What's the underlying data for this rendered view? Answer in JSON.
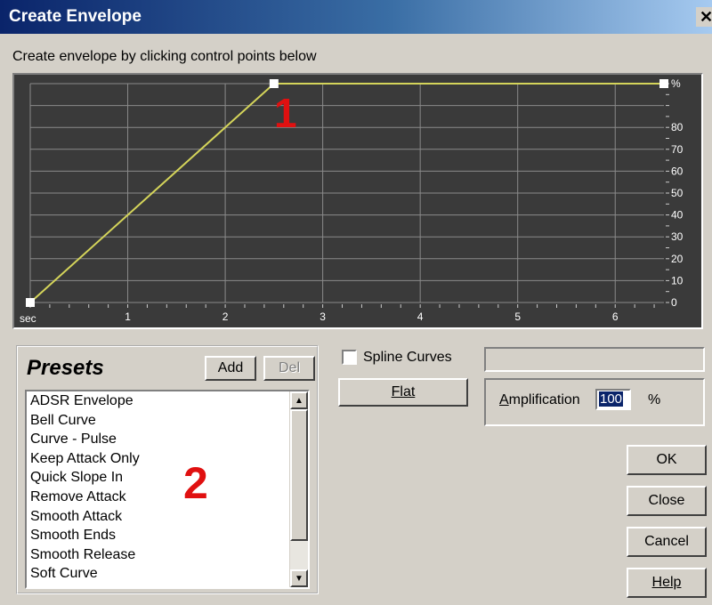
{
  "window": {
    "title": "Create Envelope",
    "close_glyph": "✕"
  },
  "instruction": "Create envelope by clicking control points below",
  "graph": {
    "y_unit": "%",
    "y_ticks": [
      80,
      70,
      60,
      50,
      40,
      30,
      20,
      10,
      0
    ],
    "x_unit": "sec",
    "x_ticks": [
      1,
      2,
      3,
      4,
      5,
      6
    ],
    "x_range": [
      0,
      6.5
    ],
    "y_range": [
      0,
      100
    ],
    "points": [
      [
        0,
        0
      ],
      [
        2.5,
        100
      ],
      [
        6.5,
        100
      ]
    ],
    "colors": {
      "background": "#3a3a3a",
      "grid": "#8a8a8a",
      "line": "#d4d45a",
      "point": "#ffffff"
    }
  },
  "annotations": {
    "one": "1",
    "two": "2",
    "color": "#e01010"
  },
  "presets": {
    "title": "Presets",
    "add_label": "Add",
    "del_label": "Del",
    "items": [
      "ADSR Envelope",
      "Bell Curve",
      "Curve - Pulse",
      "Keep Attack Only",
      "Quick Slope In",
      "Remove Attack",
      "Smooth Attack",
      "Smooth Ends",
      "Smooth Release",
      "Soft Curve"
    ]
  },
  "spline": {
    "label": "Spline Curves",
    "checked": false
  },
  "flat_label": "Flat",
  "amplification": {
    "label": "Amplification",
    "value": "100",
    "unit": "%"
  },
  "buttons": {
    "ok": "OK",
    "close": "Close",
    "cancel": "Cancel",
    "help": "Help"
  }
}
